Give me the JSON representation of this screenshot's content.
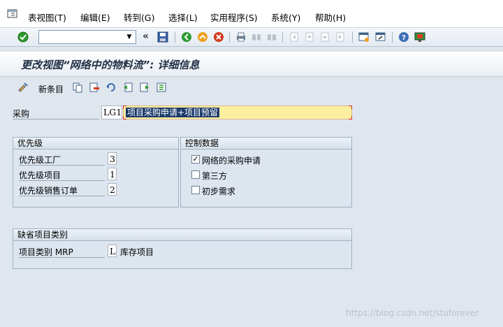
{
  "menu": {
    "items": [
      {
        "label": "表视图(T)"
      },
      {
        "label": "编辑(E)"
      },
      {
        "label": "转到(G)"
      },
      {
        "label": "选择(L)"
      },
      {
        "label": "实用程序(S)"
      },
      {
        "label": "系统(Y)"
      },
      {
        "label": "帮助(H)"
      }
    ]
  },
  "toolbar": {
    "command_value": "",
    "arrow": "«"
  },
  "title": "更改视图“网络中的物料流”: 详细信息",
  "app_toolbar": {
    "new_entries_label": "新条目"
  },
  "purchase": {
    "label": "采购",
    "code": "LG1",
    "description": "项目采购申请+项目预留"
  },
  "priority": {
    "header": "优先级",
    "rows": [
      {
        "label": "优先级工厂",
        "value": "3"
      },
      {
        "label": "优先级项目",
        "value": "1"
      },
      {
        "label": "优先级销售订单",
        "value": "2"
      }
    ]
  },
  "control": {
    "header": "控制数据",
    "checks": [
      {
        "label": "网络的采购申请",
        "checked": true,
        "mark": "✓"
      },
      {
        "label": "第三方",
        "checked": false,
        "mark": ""
      },
      {
        "label": "初步需求",
        "checked": false,
        "mark": ""
      }
    ]
  },
  "default_item": {
    "header": "缺省项目类别",
    "label": "项目类别 MRP",
    "value": "L",
    "description": "库存项目"
  },
  "watermark": "https://blog.csdn.net/stuforever"
}
